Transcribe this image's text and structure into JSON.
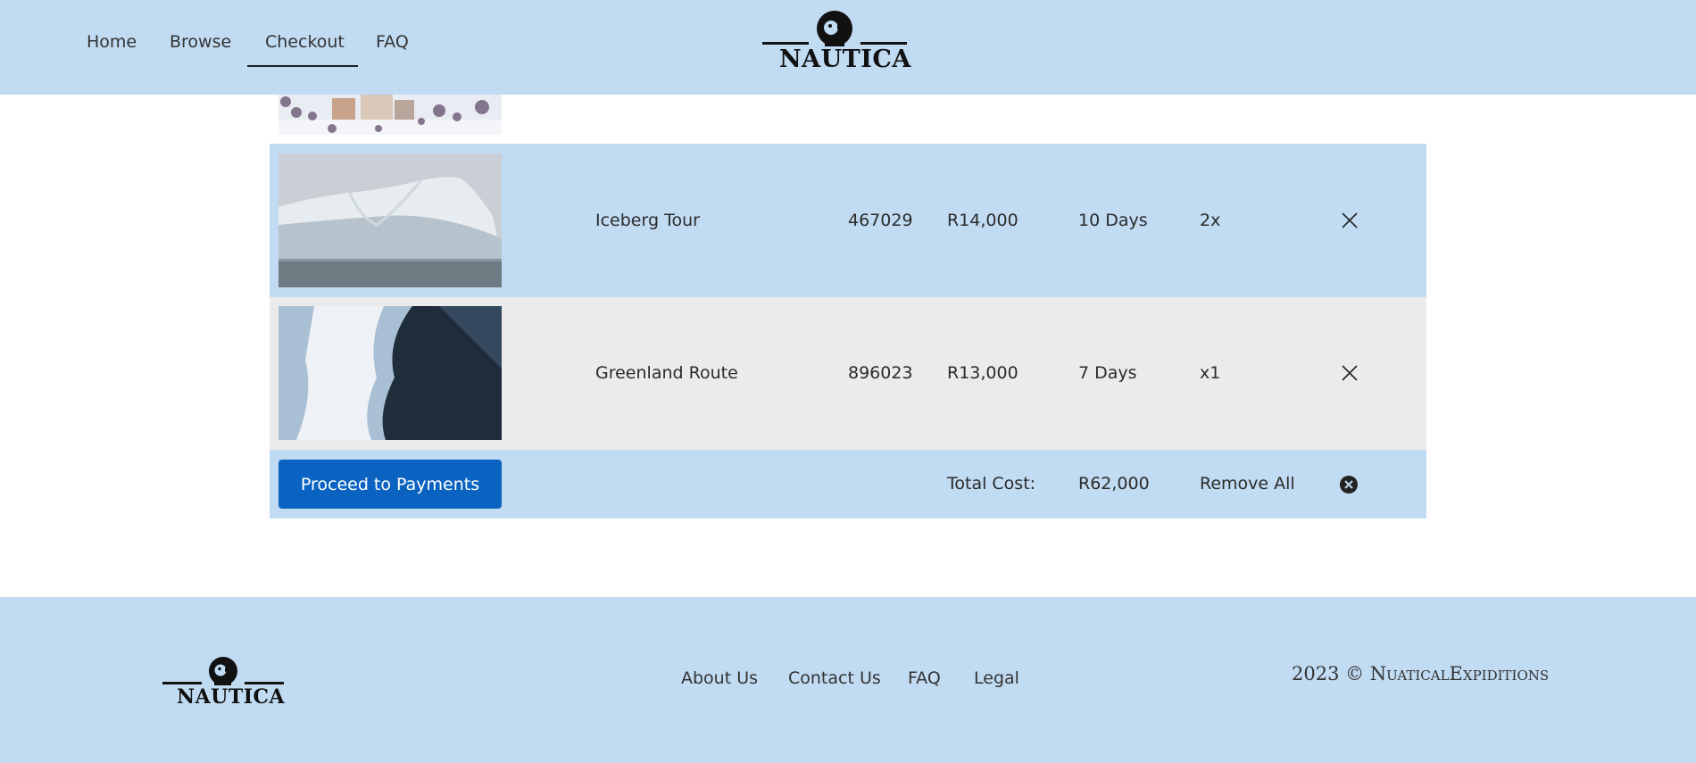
{
  "header": {
    "nav": [
      {
        "label": "Home"
      },
      {
        "label": "Browse"
      },
      {
        "label": "Checkout"
      },
      {
        "label": "FAQ"
      }
    ],
    "active_nav": "Checkout",
    "logo_text": "NAUTICA"
  },
  "cart": {
    "items": [
      {
        "name": "Iceberg Tour",
        "code": "467029",
        "price": "R14,000",
        "duration": "10 Days",
        "quantity": "2x",
        "image": "iceberg-photo"
      },
      {
        "name": "Greenland Route",
        "code": "896023",
        "price": "R13,000",
        "duration": "7 Days",
        "quantity": "x1",
        "image": "black-sand-coast-photo"
      }
    ],
    "proceed_label": "Proceed to Payments",
    "total_label": "Total Cost:",
    "total_value": "R62,000",
    "remove_all_label": "Remove All"
  },
  "footer": {
    "logo_text": "NAUTICA",
    "links": [
      {
        "label": "About Us"
      },
      {
        "label": "Contact Us"
      },
      {
        "label": "FAQ"
      },
      {
        "label": "Legal"
      }
    ],
    "copyright": "2023 © NuaticalExpiditions"
  },
  "colors": {
    "header_bg": "#c1dbf2",
    "row_alt_bg": "#ebebeb",
    "primary_button": "#0b63c1"
  }
}
